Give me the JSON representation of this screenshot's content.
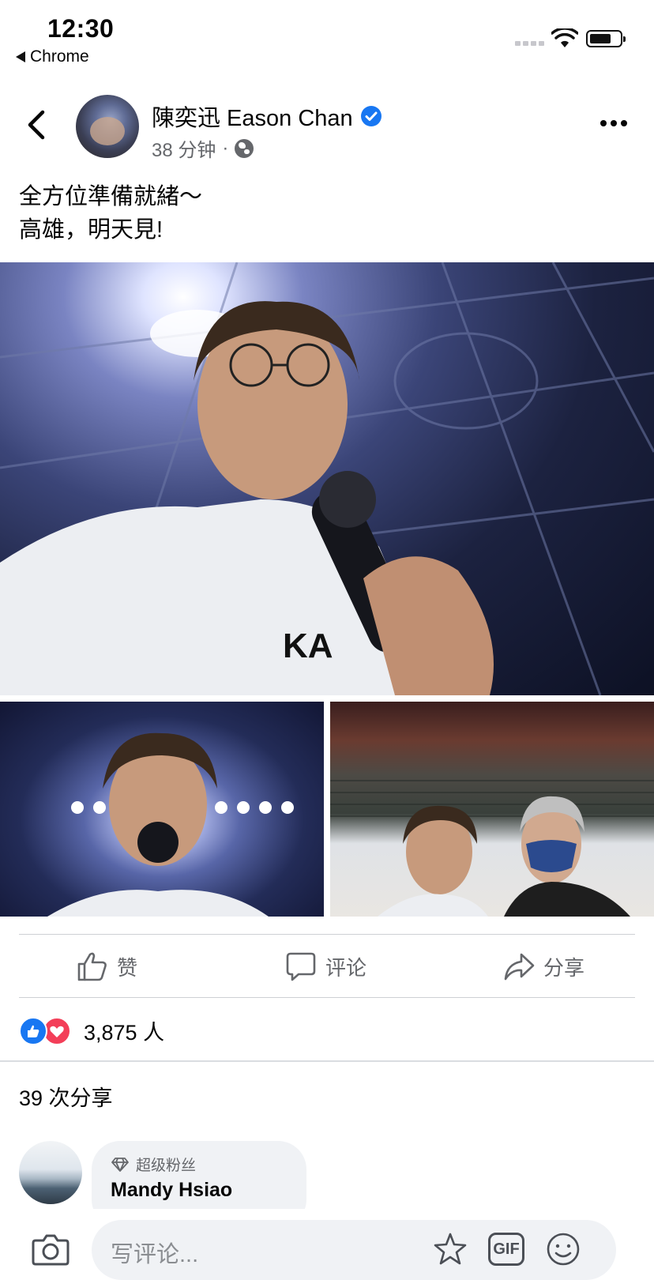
{
  "status_bar": {
    "time": "12:30",
    "back_app_label": "Chrome"
  },
  "post": {
    "author_name": "陳奕迅 Eason Chan",
    "verified": true,
    "timestamp": "38 分钟",
    "meta_separator": "·",
    "audience_icon": "globe-icon",
    "text_lines": [
      "全方位準備就緒～",
      "高雄，明天見!"
    ]
  },
  "actions": {
    "like_label": "赞",
    "comment_label": "评论",
    "share_label": "分享"
  },
  "engagement": {
    "reaction_count": "3,875 人",
    "shares_text": "39 次分享"
  },
  "comment": {
    "badge_label": "超级粉丝",
    "author_name": "Mandy Hsiao"
  },
  "composer": {
    "placeholder": "写评论...",
    "gif_label": "GIF"
  },
  "colors": {
    "accent": "#1877f2",
    "love": "#f33e58",
    "secondary_text": "#65676b"
  }
}
